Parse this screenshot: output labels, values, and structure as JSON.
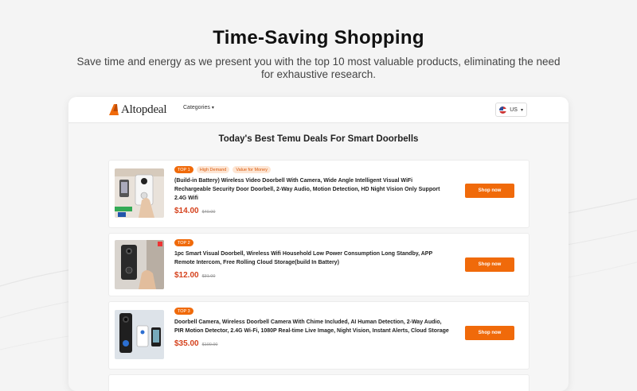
{
  "hero": {
    "title": "Time-Saving Shopping",
    "subtitle": "Save time and energy as we present you with the top 10 most valuable products, eliminating the need for exhaustive research."
  },
  "nav": {
    "logo_text": "Altopdeal",
    "categories_label": "Categories",
    "locale_label": "US"
  },
  "page": {
    "heading": "Today's Best Temu Deals For Smart Doorbells"
  },
  "products": [
    {
      "rank": "TOP 1",
      "tags": [
        "High Demand",
        "Value for Money"
      ],
      "title": "(Build-in Battery) Wireless Video Doorbell With Camera, Wide Angle Intelligent Visual WiFi Rechargeable Security Door Doorbell, 2-Way Audio, Motion Detection, HD Night Vision Only Support 2.4G Wifi",
      "price": "$14.00",
      "old_price": "$40.00",
      "button": "Shop now"
    },
    {
      "rank": "TOP 2",
      "tags": [],
      "title": "1pc Smart Visual Doorbell, Wireless Wifi Household Low Power Consumption Long Standby, APP Remote Intercom, Free Rolling Cloud Storage(build In Battery)",
      "price": "$12.00",
      "old_price": "$31.00",
      "button": "Shop now"
    },
    {
      "rank": "TOP 3",
      "tags": [],
      "title": "Doorbell Camera, Wireless Doorbell Camera With Chime Included, AI Human Detection, 2-Way Audio, PIR Motion Detector, 2.4G Wi-Fi, 1080P Real-time Live Image, Night Vision, Instant Alerts, Cloud Storage",
      "price": "$35.00",
      "old_price": "$100.00",
      "button": "Shop now"
    }
  ],
  "colors": {
    "accent": "#f06a0a",
    "price": "#d5421d"
  }
}
